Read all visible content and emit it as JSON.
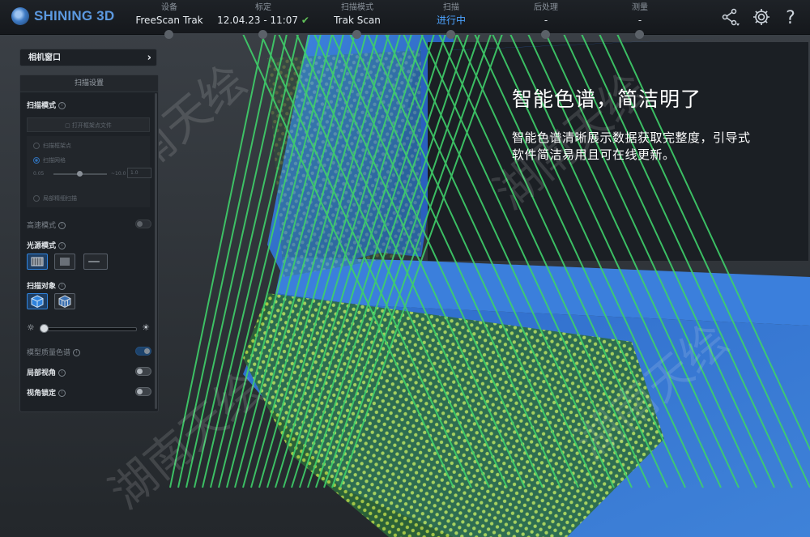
{
  "brand": {
    "name": "SHINING 3D"
  },
  "steps": [
    {
      "label": "设备",
      "value": "FreeScan Trak"
    },
    {
      "label": "标定",
      "value": "12.04.23 - 11:07",
      "status": "✔"
    },
    {
      "label": "扫描模式",
      "value": "Trak Scan"
    },
    {
      "label": "扫描",
      "value": "进行中"
    },
    {
      "label": "后处理",
      "value": "-"
    },
    {
      "label": "测量",
      "value": "-"
    }
  ],
  "toolbar_icons": [
    "share-icon",
    "gear-icon",
    "help-icon"
  ],
  "camera_window": {
    "label": "相机窗口",
    "chevron": "›"
  },
  "scan_settings": {
    "title": "扫描设置",
    "scan_mode": {
      "label": "扫描模式",
      "file_button": "打开框架点文件"
    },
    "options": [
      {
        "label": "扫描框架点",
        "selected": false
      },
      {
        "label": "扫描网格",
        "selected": true
      },
      {
        "label": "局部精细扫描",
        "selected": false
      }
    ],
    "slider": {
      "min_label": "0.05",
      "max_label": "~10.0",
      "value": "1.0"
    },
    "high_speed": {
      "label": "高速模式",
      "on": false
    },
    "light_source": {
      "label": "光源模式"
    },
    "scan_object": {
      "label": "扫描对象"
    },
    "brightness": {
      "level": 0
    },
    "quality_map": {
      "label": "模型质量色谱",
      "on": true
    },
    "local_view": {
      "label": "局部视角",
      "on": false
    },
    "view_lock": {
      "label": "视角锁定",
      "on": false
    }
  },
  "headline": "智能色谱，简洁明了",
  "description": [
    "智能色谱清晰展示数据获取完整度，引导式",
    "软件简洁易用且可在线更新。"
  ],
  "watermark": "湖南天绘",
  "colors": {
    "accent": "#4da3ff",
    "scan_blue": "#2f6fd0",
    "scan_green": "#3fd06a",
    "check": "#62c25a"
  }
}
